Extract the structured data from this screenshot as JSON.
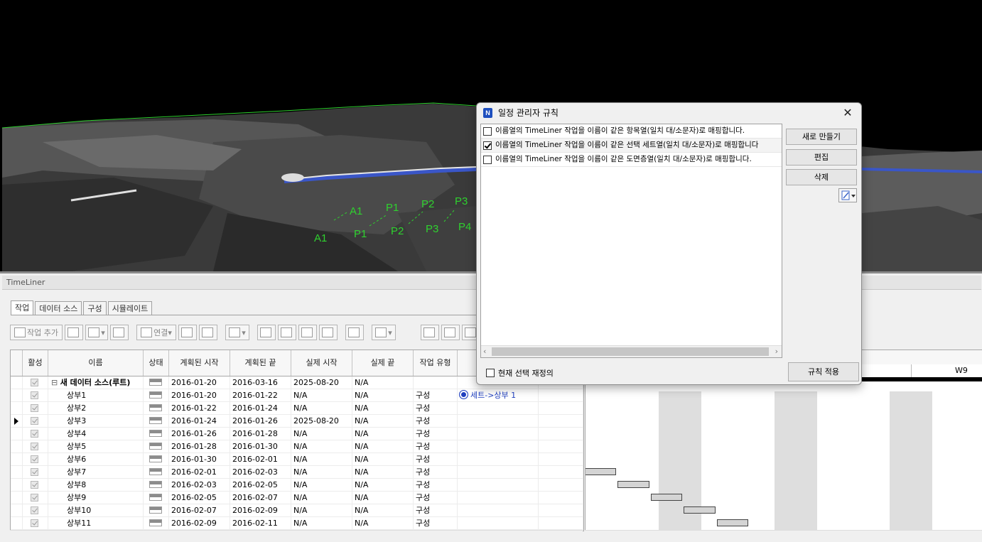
{
  "viewport": {
    "labels": [
      {
        "text": "A1"
      },
      {
        "text": "P1"
      },
      {
        "text": "P2"
      },
      {
        "text": "P3"
      },
      {
        "text": "A1"
      },
      {
        "text": "P1"
      },
      {
        "text": "P2"
      },
      {
        "text": "P3"
      },
      {
        "text": "P4"
      }
    ]
  },
  "panel": {
    "title": "TimeLiner",
    "tabs": [
      "작업",
      "데이터 소스",
      "구성",
      "시뮬레이트"
    ],
    "toolbar": {
      "add_task": "작업 추가",
      "link": "연결"
    },
    "columns": [
      "활성",
      "이름",
      "상태",
      "계획된 시작",
      "계획된 끝",
      "실제 시작",
      "실제 끝",
      "작업 유형",
      "",
      ""
    ],
    "rows": [
      {
        "name": "새 데이터 소스(루트)",
        "ps": "2016-01-20",
        "pe": "2016-03-16",
        "as": "2025-08-20",
        "ae": "N/A",
        "type": "",
        "attach": "",
        "root": true
      },
      {
        "name": "상부1",
        "ps": "2016-01-20",
        "pe": "2016-01-22",
        "as": "N/A",
        "ae": "N/A",
        "type": "구성",
        "attach": "세트->상부 1"
      },
      {
        "name": "상부2",
        "ps": "2016-01-22",
        "pe": "2016-01-24",
        "as": "N/A",
        "ae": "N/A",
        "type": "구성",
        "attach": ""
      },
      {
        "name": "상부3",
        "ps": "2016-01-24",
        "pe": "2016-01-26",
        "as": "2025-08-20",
        "ae": "N/A",
        "type": "구성",
        "attach": "",
        "current": true
      },
      {
        "name": "상부4",
        "ps": "2016-01-26",
        "pe": "2016-01-28",
        "as": "N/A",
        "ae": "N/A",
        "type": "구성",
        "attach": ""
      },
      {
        "name": "상부5",
        "ps": "2016-01-28",
        "pe": "2016-01-30",
        "as": "N/A",
        "ae": "N/A",
        "type": "구성",
        "attach": ""
      },
      {
        "name": "상부6",
        "ps": "2016-01-30",
        "pe": "2016-02-01",
        "as": "N/A",
        "ae": "N/A",
        "type": "구성",
        "attach": ""
      },
      {
        "name": "상부7",
        "ps": "2016-02-01",
        "pe": "2016-02-03",
        "as": "N/A",
        "ae": "N/A",
        "type": "구성",
        "attach": ""
      },
      {
        "name": "상부8",
        "ps": "2016-02-03",
        "pe": "2016-02-05",
        "as": "N/A",
        "ae": "N/A",
        "type": "구성",
        "attach": ""
      },
      {
        "name": "상부9",
        "ps": "2016-02-05",
        "pe": "2016-02-07",
        "as": "N/A",
        "ae": "N/A",
        "type": "구성",
        "attach": ""
      },
      {
        "name": "상부10",
        "ps": "2016-02-07",
        "pe": "2016-02-09",
        "as": "N/A",
        "ae": "N/A",
        "type": "구성",
        "attach": ""
      },
      {
        "name": "상부11",
        "ps": "2016-02-09",
        "pe": "2016-02-11",
        "as": "N/A",
        "ae": "N/A",
        "type": "구성",
        "attach": ""
      }
    ]
  },
  "gantt": {
    "week_label": "W9"
  },
  "dialog": {
    "title": "일정 관리자 규칙",
    "app_icon_letter": "N",
    "rules": [
      {
        "text": "이름열의 TimeLiner 작업을 이름이 같은 항목열(일치 대/소문자)로 매핑합니다.",
        "checked": false
      },
      {
        "text": "이름열의 TimeLiner 작업을 이름이 같은 선택 세트열(일치 대/소문자)로 매핑합니다",
        "checked": true
      },
      {
        "text": "이름열의 TimeLiner 작업을 이름이 같은 도면층열(일치 대/소문자)로 매핑합니다.",
        "checked": false
      }
    ],
    "buttons": {
      "new": "새로 만들기",
      "edit": "편집",
      "delete": "삭제",
      "apply": "규칙 적용"
    },
    "redefine_label": "현재 선택 재정의"
  }
}
